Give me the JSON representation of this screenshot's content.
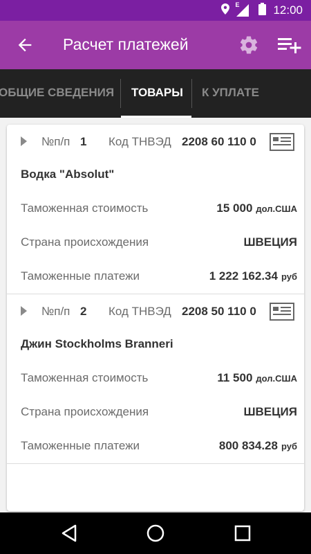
{
  "status_bar": {
    "time": "12:00",
    "network_label": "E",
    "icons": [
      "location-icon",
      "signal-icon",
      "battery-icon"
    ]
  },
  "app_bar": {
    "title": "Расчет платежей",
    "back_icon": "arrow-back-icon",
    "settings_icon": "gear-icon",
    "add_icon": "playlist-add-icon"
  },
  "tabs": [
    {
      "label": "ОБЩИЕ СВЕДЕНИЯ",
      "active": false
    },
    {
      "label": "ТОВАРЫ",
      "active": true
    },
    {
      "label": "К УПЛАТЕ",
      "active": false
    }
  ],
  "items": [
    {
      "num_label": "№п/п",
      "num": "1",
      "code_label": "Код ТНВЭД",
      "code": "2208 60 110 0",
      "name": "Водка \"Absolut\"",
      "fields": [
        {
          "label": "Таможенная стоимость",
          "value": "15 000",
          "unit": "дол.США"
        },
        {
          "label": "Страна происхождения",
          "value": "ШВЕЦИЯ",
          "unit": ""
        },
        {
          "label": "Таможенные платежи",
          "value": "1 222 162.34",
          "unit": "руб"
        }
      ]
    },
    {
      "num_label": "№п/п",
      "num": "2",
      "code_label": "Код ТНВЭД",
      "code": "2208 50 110 0",
      "name": "Джин Stockholms Branneri",
      "fields": [
        {
          "label": "Таможенная стоимость",
          "value": "11 500",
          "unit": "дол.США"
        },
        {
          "label": "Страна происхождения",
          "value": "ШВЕЦИЯ",
          "unit": ""
        },
        {
          "label": "Таможенные платежи",
          "value": "800 834.28",
          "unit": "руб"
        }
      ]
    }
  ],
  "colors": {
    "status_bar": "#7b1fa2",
    "app_bar": "#9c3ba6",
    "tab_bar": "#222222",
    "nav_bar": "#000000"
  }
}
